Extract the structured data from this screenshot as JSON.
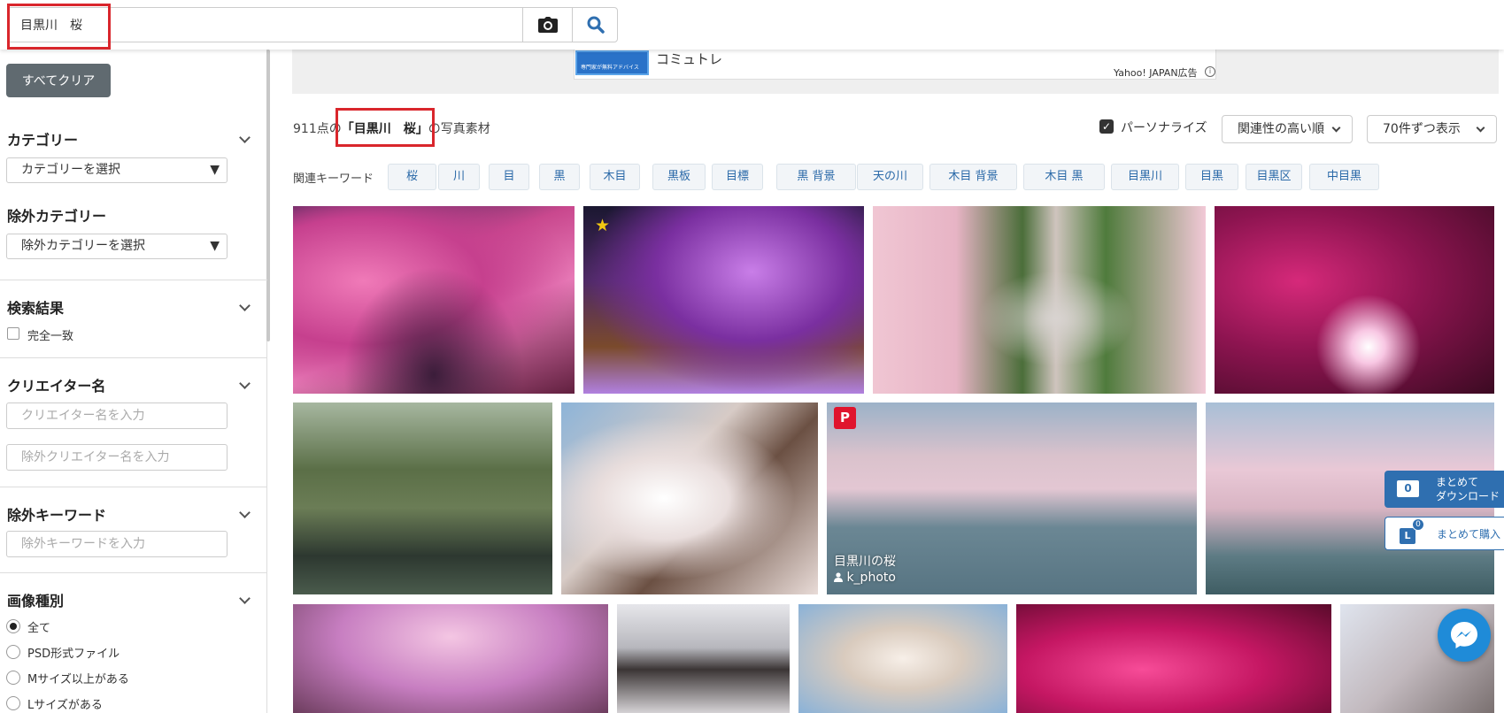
{
  "search": {
    "value": "目黒川　桜",
    "camera_icon": "camera-icon",
    "search_icon": "search-icon"
  },
  "ad": {
    "text": "コミュトレ",
    "thumb_text": "専門家が無料アドバイス",
    "label": "Yahoo! JAPAN広告",
    "info": "i"
  },
  "sidebar": {
    "clear_all": "すべてクリア",
    "category": {
      "title": "カテゴリー",
      "select": "カテゴリーを選択"
    },
    "exclude_category": {
      "title": "除外カテゴリー",
      "select": "除外カテゴリーを選択"
    },
    "search_results": {
      "title": "検索結果",
      "exact_match": "完全一致"
    },
    "creator": {
      "title": "クリエイター名",
      "placeholder": "クリエイター名を入力",
      "exclude_placeholder": "除外クリエイター名を入力"
    },
    "exclude_keyword": {
      "title": "除外キーワード",
      "placeholder": "除外キーワードを入力"
    },
    "image_type": {
      "title": "画像種別",
      "options": [
        "全て",
        "PSD形式ファイル",
        "Mサイズ以上がある",
        "Lサイズがある"
      ],
      "selected": "全て"
    }
  },
  "results": {
    "count_prefix": "911点の",
    "query_label": "「目黒川　桜」",
    "count_suffix": "の写真素材",
    "personalize": "パーソナライズ",
    "personalize_checked": true,
    "sort": "関連性の高い順",
    "per_page": "70件ずつ表示"
  },
  "related": {
    "label": "関連キーワード",
    "keywords": [
      "桜",
      "川",
      "目",
      "黒",
      "木目",
      "黒板",
      "目標",
      "黒 背景",
      "天の川",
      "木目 背景",
      "木目 黒",
      "目黒川",
      "目黒",
      "目黒区",
      "中目黒"
    ]
  },
  "photo_overlay": {
    "title": "目黒川の桜",
    "author": "k_photo",
    "pinterest": "P",
    "star": "★"
  },
  "floating": {
    "download_count": "0",
    "download_line1": "まとめて",
    "download_line2": "ダウンロード",
    "buy_icon": "L",
    "buy_count": "0",
    "buy_label": "まとめて購入",
    "messenger_icon": "messenger-icon"
  },
  "colors": {
    "highlight": "#d9262c",
    "link": "#2a69a8",
    "accent": "#2f6fb0"
  }
}
